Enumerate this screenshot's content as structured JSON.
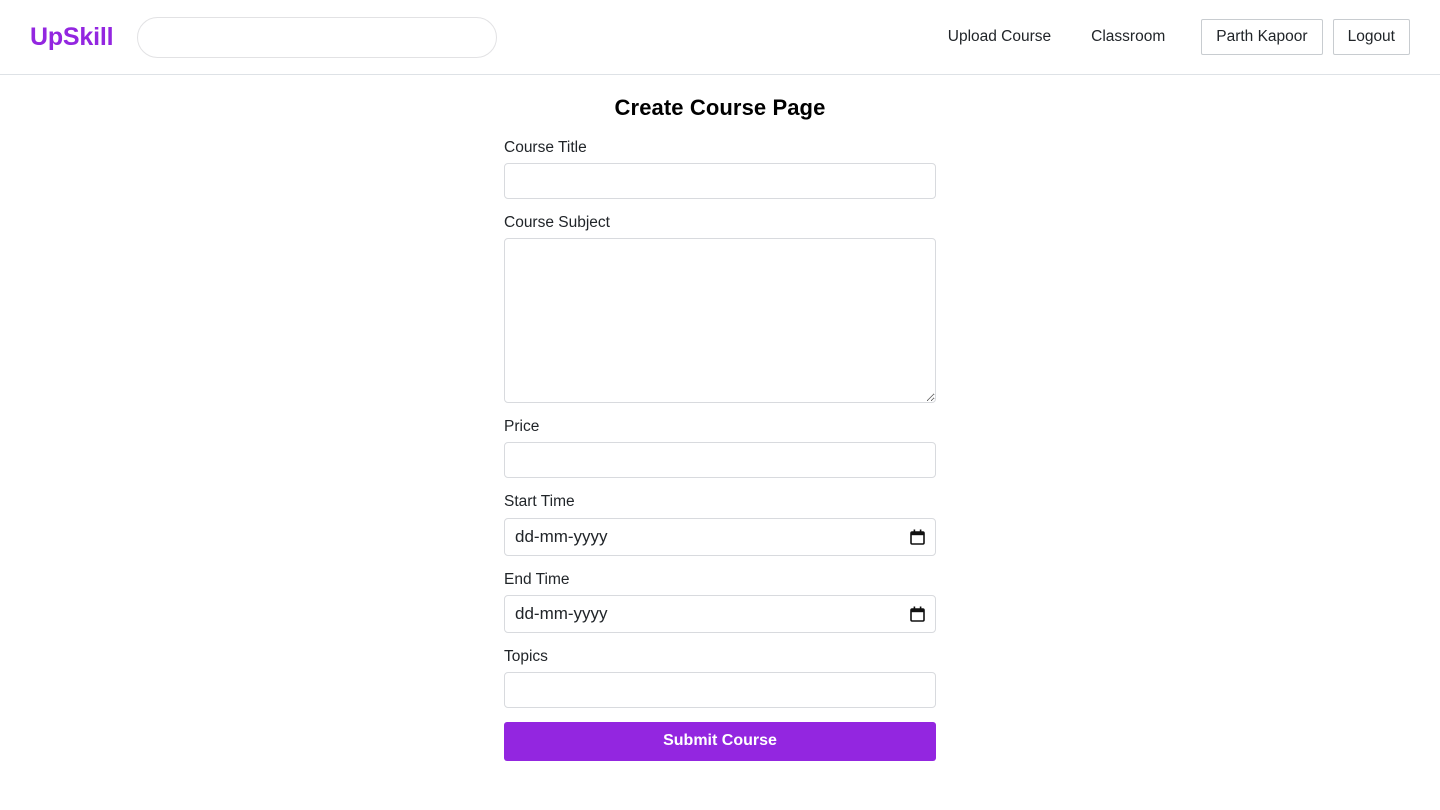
{
  "navbar": {
    "brand": "UpSkill",
    "search": {
      "value": "",
      "placeholder": ""
    },
    "links": [
      {
        "label": "Upload Course",
        "name": "nav-link-upload-course"
      },
      {
        "label": "Classroom",
        "name": "nav-link-classroom"
      }
    ],
    "buttons": [
      {
        "label": "Parth Kapoor",
        "name": "nav-button-user-profile"
      },
      {
        "label": "Logout",
        "name": "nav-button-logout"
      }
    ]
  },
  "main": {
    "title": "Create Course Page",
    "fields": {
      "course_title": {
        "label": "Course Title",
        "value": "",
        "placeholder": ""
      },
      "course_subject": {
        "label": "Course Subject",
        "value": "",
        "placeholder": ""
      },
      "price": {
        "label": "Price",
        "value": "",
        "placeholder": ""
      },
      "start_time": {
        "label": "Start Time",
        "value": "dd-mm-yyyy"
      },
      "end_time": {
        "label": "End Time",
        "value": "dd-mm-yyyy"
      },
      "topics": {
        "label": "Topics",
        "value": "",
        "placeholder": ""
      }
    },
    "submit_label": "Submit Course"
  },
  "colors": {
    "brand_purple": "#9326e0",
    "submit_purple": "#9326e0",
    "text": "#212529",
    "border": "#d8dade",
    "navbar_border": "#dee2e6"
  },
  "icons": {
    "calendar": "calendar-icon",
    "resize_handle": "resize-handle-icon"
  }
}
